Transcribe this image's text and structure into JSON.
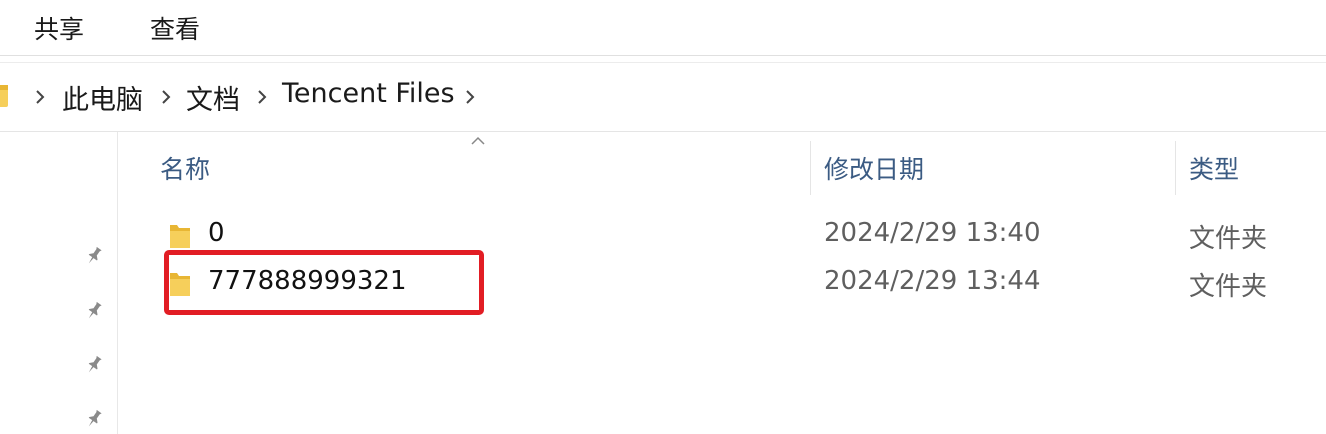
{
  "ribbon": {
    "tabs": [
      {
        "label": "共享"
      },
      {
        "label": "查看"
      }
    ]
  },
  "breadcrumb": {
    "items": [
      {
        "label": "此电脑"
      },
      {
        "label": "文档"
      },
      {
        "label": "Tencent Files"
      }
    ]
  },
  "columns": {
    "name": "名称",
    "modified": "修改日期",
    "type": "类型"
  },
  "files": [
    {
      "name": "0",
      "modified": "2024/2/29 13:40",
      "type": "文件夹",
      "icon": "folder-icon"
    },
    {
      "name": "777888999321",
      "modified": "2024/2/29 13:44",
      "type": "文件夹",
      "icon": "folder-icon"
    }
  ],
  "colors": {
    "header_text": "#3b5b83",
    "highlight": "#e21d24",
    "folder": "#f6cf5b"
  }
}
